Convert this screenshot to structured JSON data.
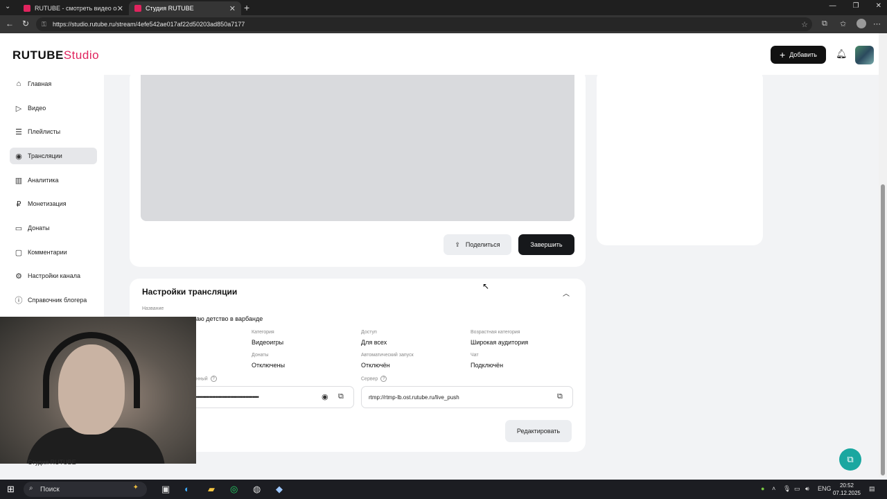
{
  "browser": {
    "tabs": [
      {
        "title": "RUTUBE - смотреть видео онлайн",
        "favicon_color": "#e0245e"
      },
      {
        "title": "Студия RUTUBE",
        "favicon_color": "#e0245e"
      }
    ],
    "url": "https://studio.rutube.ru/stream/4efe542ae017af22d50203ad850a7177"
  },
  "header": {
    "logo_main": "RUTUBE",
    "logo_studio": "Studio",
    "add_label": "Добавить"
  },
  "sidebar": {
    "items": [
      {
        "label": "Главная",
        "icon": "home-icon"
      },
      {
        "label": "Видео",
        "icon": "video-icon"
      },
      {
        "label": "Плейлисты",
        "icon": "playlist-icon"
      },
      {
        "label": "Трансляции",
        "icon": "broadcast-icon",
        "active": true
      },
      {
        "label": "Аналитика",
        "icon": "analytics-icon"
      },
      {
        "label": "Монетизация",
        "icon": "money-icon"
      },
      {
        "label": "Донаты",
        "icon": "donate-icon"
      },
      {
        "label": "Комментарии",
        "icon": "comment-icon"
      },
      {
        "label": "Настройки канала",
        "icon": "gear-icon"
      },
      {
        "label": "Справочник блогера",
        "icon": "info-icon"
      }
    ],
    "bottom_partial": "Студия RUTUBE"
  },
  "player": {
    "share_label": "Поделиться",
    "finish_label": "Завершить"
  },
  "settings": {
    "title": "Настройки трансляции",
    "name_label": "Название",
    "name_value_partial": "аю детство в варбанде",
    "category_label": "Категория",
    "category_value": "Видеоигры",
    "access_label": "Доступ",
    "access_value": "Для всех",
    "age_label": "Возрастная категория",
    "age_value": "Широкая аудитория",
    "donates_label": "Донаты",
    "donates_value": "Отключены",
    "autostart_label": "Автоматический запуск",
    "autostart_value": "Отключён",
    "chat_label": "Чат",
    "chat_value": "Подключён",
    "key_label_partial": "нный",
    "key_masked": "••••••••••••••••••••••••••••••••••••••••••••••",
    "server_label": "Сервер",
    "server_value": "rtmp://rtmp-lb.ost.rutube.ru/live_push",
    "edit_label": "Редактировать"
  },
  "taskbar": {
    "search_label": "Поиск",
    "lang": "ENG",
    "time": "20:52",
    "date": "07.12.2025"
  },
  "colors": {
    "accent": "#e0245e",
    "primary_button": "#16181b",
    "chat_fab": "#1aa7a0"
  }
}
